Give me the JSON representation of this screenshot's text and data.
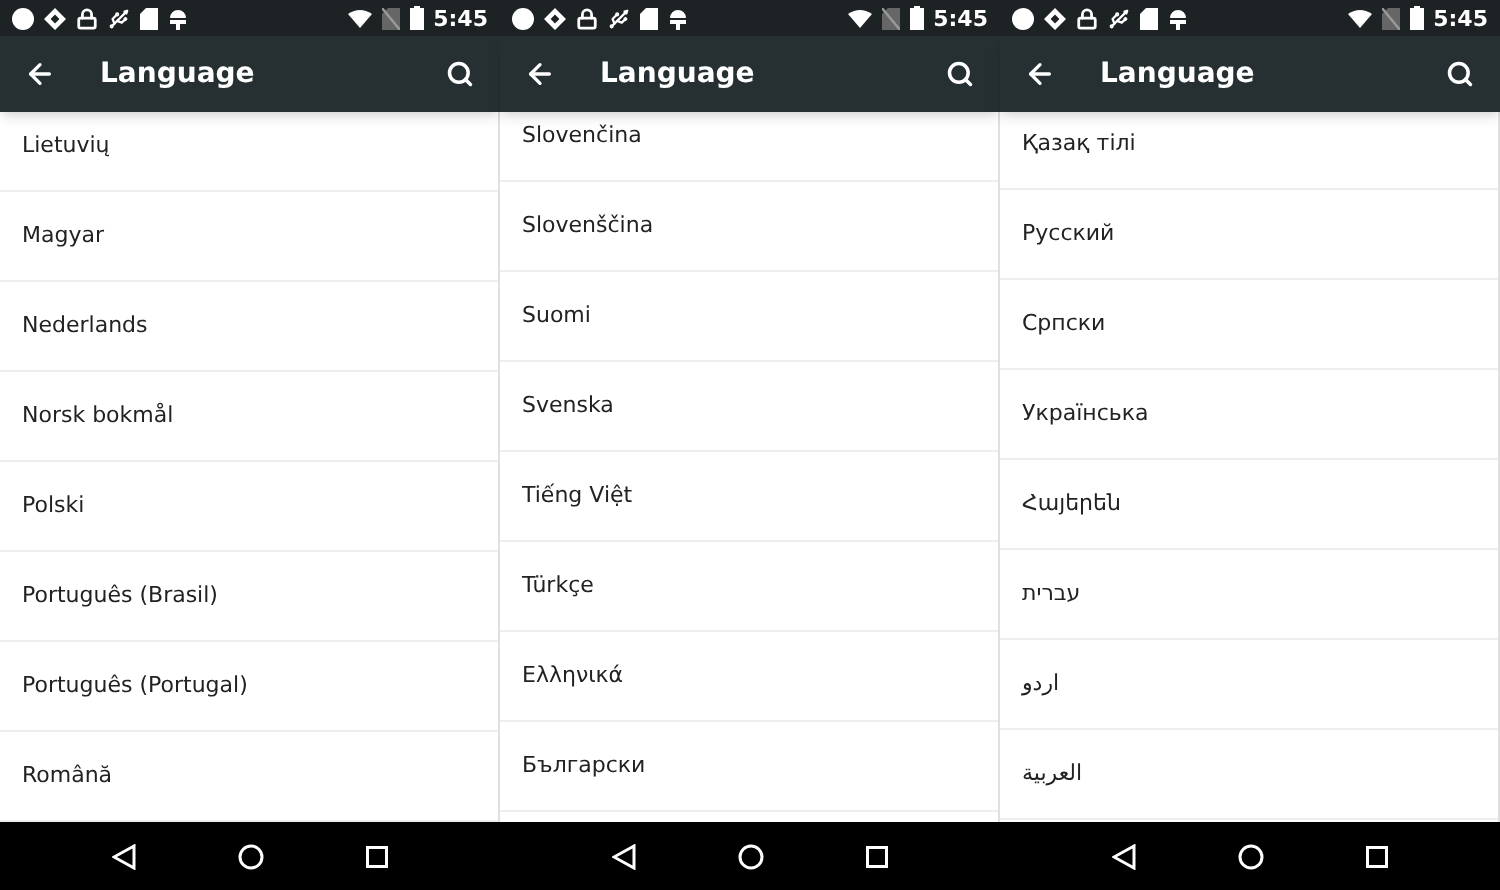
{
  "screens": [
    {
      "status_bar": {
        "time": "5:45"
      },
      "toolbar": {
        "title": "Language"
      },
      "languages": [
        "Lietuvių",
        "Magyar",
        "Nederlands",
        "Norsk bokmål",
        "Polski",
        "Português (Brasil)",
        "Português (Portugal)",
        "Română"
      ]
    },
    {
      "status_bar": {
        "time": "5:45"
      },
      "toolbar": {
        "title": "Language"
      },
      "languages": [
        "Slovenčina",
        "Slovenščina",
        "Suomi",
        "Svenska",
        "Tiếng Việt",
        "Türkçe",
        "Ελληνικά",
        "Български"
      ]
    },
    {
      "status_bar": {
        "time": "5:45"
      },
      "toolbar": {
        "title": "Language"
      },
      "languages": [
        "Қазақ тілі",
        "Русский",
        "Српски",
        "Українська",
        "Հայերեն",
        "עברית",
        "اردو",
        "العربية"
      ]
    }
  ]
}
